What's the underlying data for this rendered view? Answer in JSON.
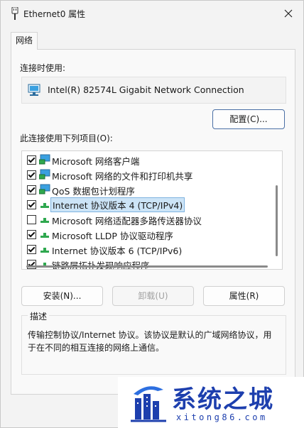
{
  "window": {
    "title": "Ethernet0 属性",
    "accent": "#0067c0"
  },
  "tabs": [
    {
      "label": "网络",
      "active": true
    }
  ],
  "connect_using_label": "连接时使用:",
  "adapter": {
    "name": "Intel(R) 82574L Gigabit Network Connection",
    "icon": "network-adapter-icon"
  },
  "configure_button": "配置(C)...",
  "items_label": "此连接使用下列项目(O):",
  "items": [
    {
      "label": "Microsoft 网络客户端",
      "checked": true,
      "icon": "network-client-icon"
    },
    {
      "label": "Microsoft 网络的文件和打印机共享",
      "checked": true,
      "icon": "network-client-icon"
    },
    {
      "label": "QoS 数据包计划程序",
      "checked": true,
      "icon": "network-client-icon"
    },
    {
      "label": "Internet 协议版本 4 (TCP/IPv4)",
      "checked": true,
      "icon": "protocol-icon",
      "selected": true
    },
    {
      "label": "Microsoft 网络适配器多路传送器协议",
      "checked": false,
      "icon": "protocol-icon"
    },
    {
      "label": "Microsoft LLDP 协议驱动程序",
      "checked": true,
      "icon": "protocol-icon"
    },
    {
      "label": "Internet 协议版本 6 (TCP/IPv6)",
      "checked": true,
      "icon": "protocol-icon"
    },
    {
      "label": "链路层拓扑发现响应程序",
      "checked": true,
      "icon": "protocol-icon"
    }
  ],
  "buttons": {
    "install": "安装(N)...",
    "uninstall": "卸载(U)",
    "properties": "属性(R)"
  },
  "description": {
    "title": "描述",
    "text": "传输控制协议/Internet 协议。该协议是默认的广域网络协议，用于在不同的相互连接的网络上通信。"
  },
  "watermark": {
    "title": "系统之城",
    "url": "xitong86.com",
    "color": "#1d3fae"
  }
}
